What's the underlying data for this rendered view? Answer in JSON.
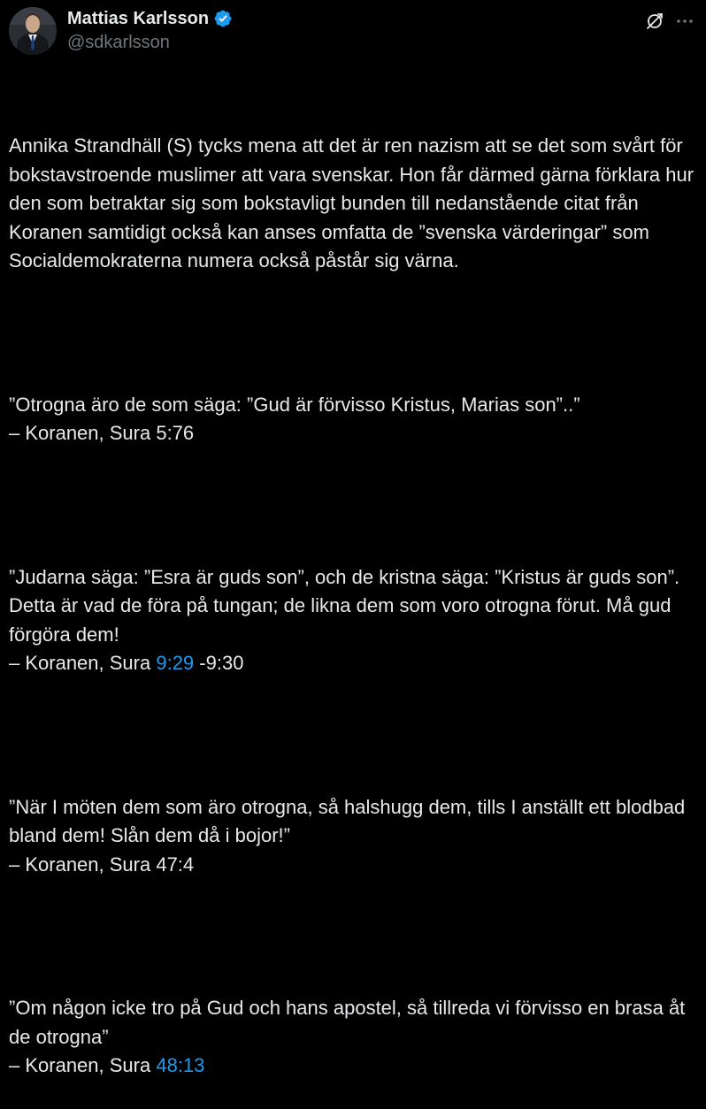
{
  "author": {
    "display_name": "Mattias Karlsson",
    "handle": "@sdkarlsson",
    "verified_color": "#1d9bf0"
  },
  "icons": {
    "grok": "grok-icon",
    "more": "more-options-icon",
    "verified": "verified-badge-icon"
  },
  "colors": {
    "background": "#000000",
    "text": "#e7e9ea",
    "secondary_text": "#71767b",
    "link": "#1d9bf0"
  },
  "tweet": {
    "intro": "Annika Strandhäll (S) tycks mena att det är ren nazism att se det som svårt för bokstavstroende muslimer att vara svenskar. Hon får därmed gärna förklara hur den som betraktar sig som bokstavligt bunden till nedanstående citat från Koranen samtidigt också kan anses omfatta de ”svenska värderingar” som Socialdemokraterna numera också påstår sig värna.",
    "quote1": {
      "text": "”Otrogna äro de som säga: ”Gud är förvisso Kristus, Marias son”..”",
      "source": "– Koranen, Sura 5:76"
    },
    "quote2": {
      "text": "”Judarna säga: ”Esra är guds son”, och de kristna säga: ”Kristus är guds son”. Detta är vad de föra på tungan; de likna dem som voro otrogna förut. Må gud förgöra dem!",
      "source_prefix": "– Koranen, Sura ",
      "source_link": "9:29",
      "source_suffix": " -9:30"
    },
    "quote3": {
      "text": "”När I möten dem som äro otrogna, så halshugg dem, tills I anställt ett blodbad bland dem! Slån dem då i bojor!”",
      "source": "– Koranen, Sura 47:4"
    },
    "quote4": {
      "text": "”Om någon icke tro på Gud och hans apostel, så tillreda vi förvisso en brasa åt de otrogna”",
      "source_prefix": "– Koranen, Sura ",
      "source_link": "48:13"
    }
  }
}
